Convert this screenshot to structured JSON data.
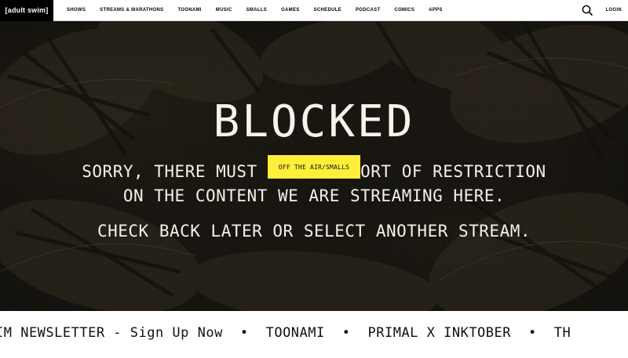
{
  "nav": {
    "logo": "[adult swim]",
    "items": [
      {
        "label": "SHOWS"
      },
      {
        "label": "STREAMS & MARATHONS"
      },
      {
        "label": "TOONAMI"
      },
      {
        "label": "MUSIC"
      },
      {
        "label": "SMALLS"
      },
      {
        "label": "GAMES"
      },
      {
        "label": "SCHEDULE"
      },
      {
        "label": "PODCAST"
      },
      {
        "label": "COMICS"
      },
      {
        "label": "APPS"
      }
    ],
    "search_icon": "search-icon",
    "login": "LOGIN"
  },
  "hero": {
    "title": "BLOCKED",
    "line1": "SORRY, THERE MUST BE SOME SORT OF RESTRICTION",
    "line2": "ON THE CONTENT WE ARE STREAMING HERE.",
    "line3": "CHECK BACK LATER OR SELECT ANOTHER STREAM.",
    "badge": "OFF THE AIR/SMALLS"
  },
  "ticker": {
    "items": [
      {
        "label": "IM NEWSLETTER - Sign Up Now"
      },
      {
        "label": "TOONAMI"
      },
      {
        "label": "PRIMAL X INKTOBER"
      },
      {
        "label": "TH"
      }
    ],
    "separator": "•"
  },
  "colors": {
    "badge_bg": "#ffee3a",
    "nav_bg": "#ffffff",
    "logo_bg": "#000000",
    "hero_text": "#f3f1ea"
  }
}
